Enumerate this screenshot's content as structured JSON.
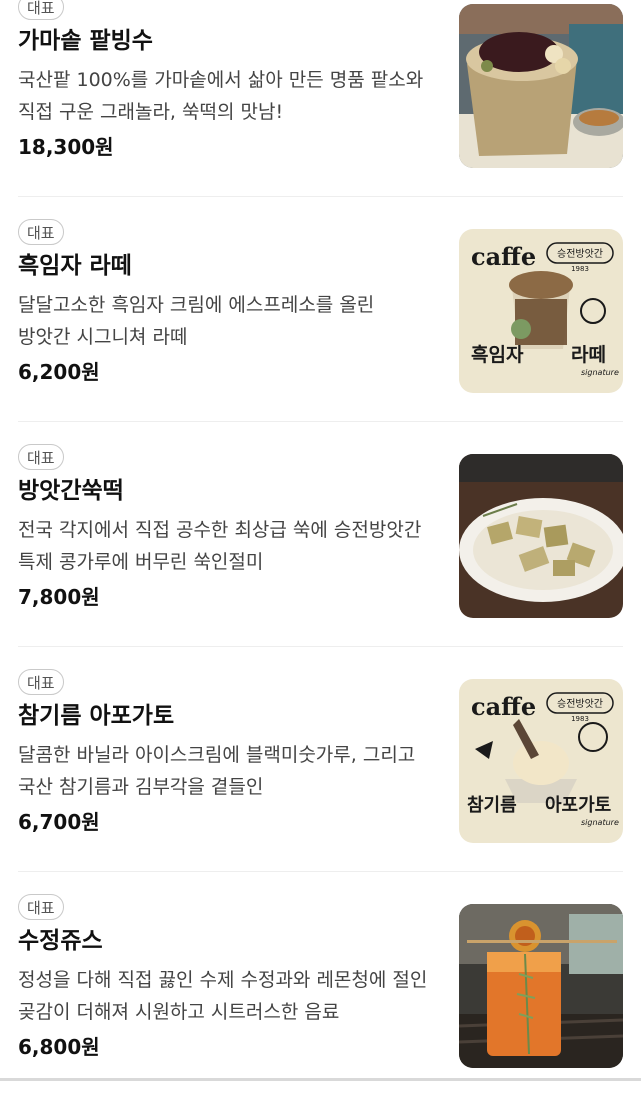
{
  "menu_items": [
    {
      "badge": "대표",
      "name": "가마솥 팥빙수",
      "description": "국산팥 100%를 가마솥에서 삶아 만든 명품 팥소와 직접 구운 그래놀라, 쑥떡의 맛남!",
      "price": "18,300원"
    },
    {
      "badge": "대표",
      "name": "흑임자 라떼",
      "description": "달달고소한 흑임자 크림에 에스프레소를 올린 방앗간 시그니쳐 라떼",
      "price": "6,200원",
      "image_text": {
        "word": "caffe",
        "stamp": "승전방앗간",
        "year": "1983",
        "title_left": "흑임자",
        "title_right": "라떼",
        "script": "signature"
      }
    },
    {
      "badge": "대표",
      "name": "방앗간쑥떡",
      "description": "전국 각지에서 직접 공수한 최상급 쑥에 승전방앗간 특제 콩가루에 버무린 쑥인절미",
      "price": "7,800원"
    },
    {
      "badge": "대표",
      "name": "참기름 아포가토",
      "description": "달콤한 바닐라 아이스크림에 블랙미숫가루, 그리고 국산 참기름과 김부각을 곁들인",
      "price": "6,700원",
      "image_text": {
        "word": "caffe",
        "stamp": "승전방앗간",
        "year": "1983",
        "title_left": "참기름",
        "title_right": "아포가토",
        "script": "signature"
      }
    },
    {
      "badge": "대표",
      "name": "수정쥬스",
      "description": "정성을 다해 직접 끓인 수제 수정과와 레몬청에 절인 곶감이 더해져 시원하고 시트러스한 음료",
      "price": "6,800원"
    }
  ]
}
